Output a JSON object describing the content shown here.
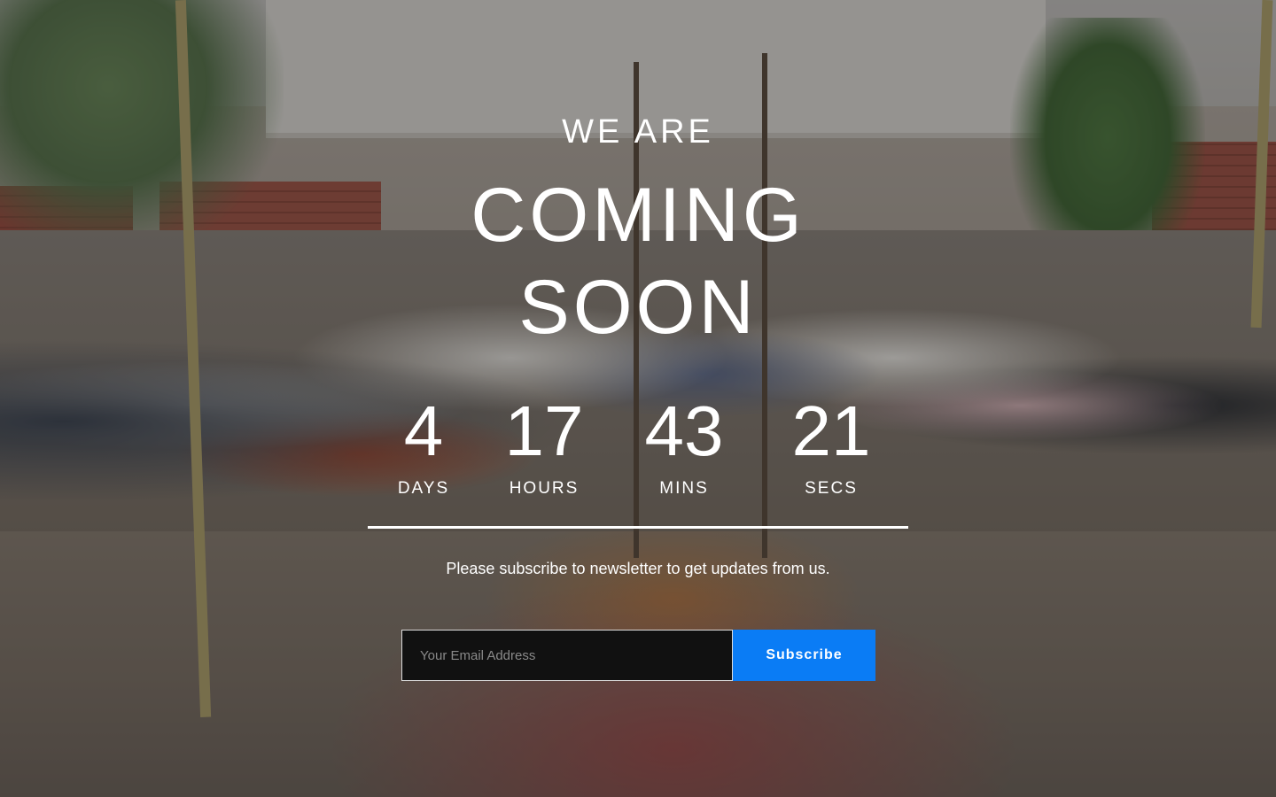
{
  "hero": {
    "kicker": "WE ARE",
    "headline_line1": "COMING",
    "headline_line2": "SOON"
  },
  "countdown": [
    {
      "value": "4",
      "label": "DAYS"
    },
    {
      "value": "17",
      "label": "HOURS"
    },
    {
      "value": "43",
      "label": "MINS"
    },
    {
      "value": "21",
      "label": "SECS"
    }
  ],
  "newsletter": {
    "text": "Please subscribe to newsletter to get updates from us.",
    "email_placeholder": "Your Email Address",
    "email_value": "",
    "button_label": "Subscribe"
  },
  "colors": {
    "button": "#0a7cf5",
    "input_bg": "#111111",
    "text": "#ffffff"
  }
}
